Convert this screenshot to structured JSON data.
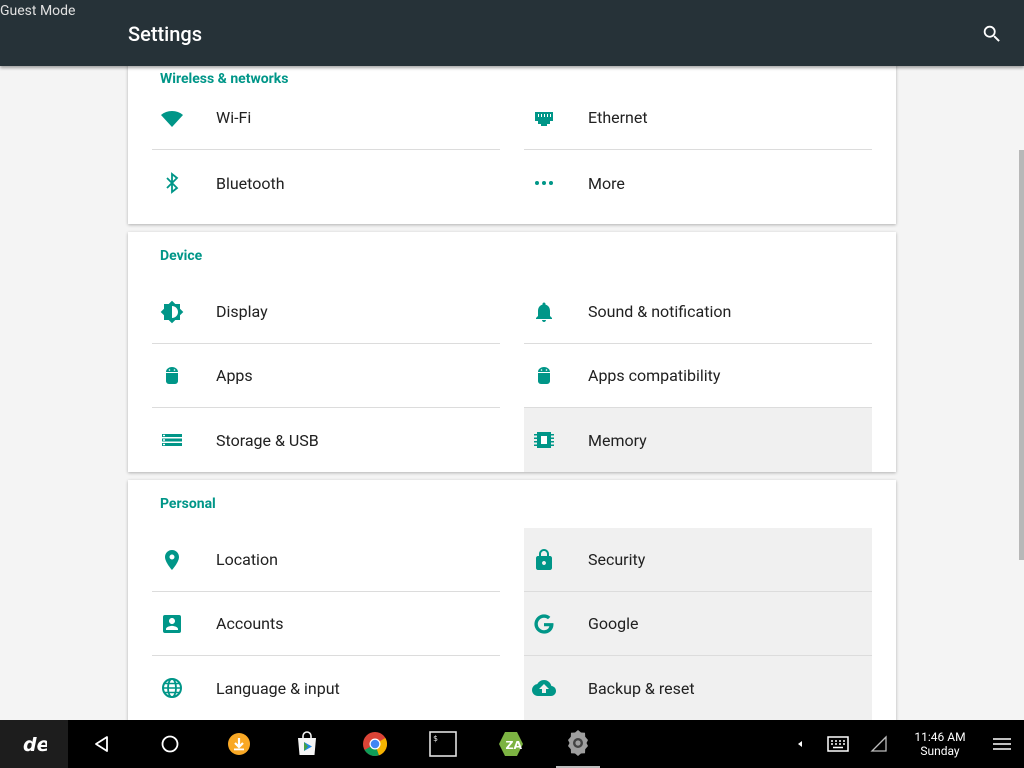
{
  "status": {
    "guest_mode": "Guest Mode"
  },
  "appbar": {
    "title": "Settings",
    "search_icon": "search-icon"
  },
  "sections": {
    "wireless": {
      "title": "Wireless & networks",
      "items": [
        {
          "label": "Wi-Fi",
          "icon": "wifi-icon"
        },
        {
          "label": "Ethernet",
          "icon": "ethernet-icon"
        },
        {
          "label": "Bluetooth",
          "icon": "bluetooth-icon"
        },
        {
          "label": "More",
          "icon": "more-dots-icon"
        }
      ]
    },
    "device": {
      "title": "Device",
      "items": [
        {
          "label": "Display",
          "icon": "brightness-icon"
        },
        {
          "label": "Sound & notification",
          "icon": "bell-icon"
        },
        {
          "label": "Apps",
          "icon": "android-icon"
        },
        {
          "label": "Apps compatibility",
          "icon": "android-icon"
        },
        {
          "label": "Storage & USB",
          "icon": "storage-icon"
        },
        {
          "label": "Memory",
          "icon": "memory-chip-icon"
        }
      ]
    },
    "personal": {
      "title": "Personal",
      "items": [
        {
          "label": "Location",
          "icon": "location-pin-icon"
        },
        {
          "label": "Security",
          "icon": "lock-icon"
        },
        {
          "label": "Accounts",
          "icon": "account-box-icon"
        },
        {
          "label": "Google",
          "icon": "google-icon"
        },
        {
          "label": "Language & input",
          "icon": "globe-icon"
        },
        {
          "label": "Backup & reset",
          "icon": "cloud-upload-icon"
        }
      ]
    }
  },
  "taskbar": {
    "time": "11:46 AM",
    "day": "Sunday",
    "accent_color": "#009688",
    "icons": [
      "launcher-icon",
      "back-icon",
      "home-icon",
      "download-app-icon",
      "play-store-icon",
      "chrome-icon",
      "terminal-icon",
      "file-manager-icon",
      "settings-gear-icon",
      "chevron-left-icon",
      "keyboard-icon",
      "signal-icon",
      "menu-icon"
    ]
  }
}
